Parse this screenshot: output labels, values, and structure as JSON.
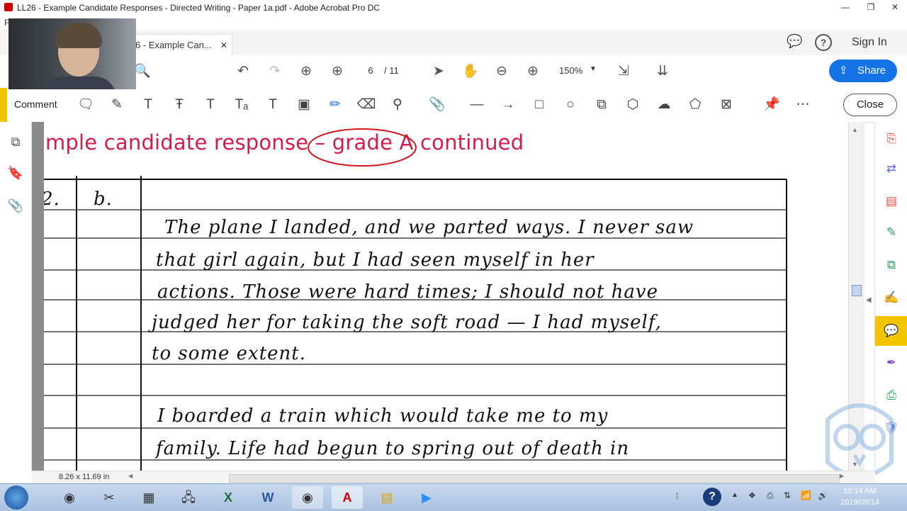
{
  "window": {
    "title": "LL26 - Example Candidate Responses - Directed Writing - Paper 1a.pdf - Adobe Acrobat Pro DC",
    "controls": [
      "—",
      "❐",
      "✕"
    ]
  },
  "menu": {
    "first": "F"
  },
  "tabs": [
    {
      "label": "6 - Example Can...",
      "close": "✕"
    }
  ],
  "topright": {
    "sign_in": "Sign In"
  },
  "toolbar": {
    "page_current": "6",
    "page_total": "/ 11",
    "zoom": "150%",
    "share_label": "Share"
  },
  "comment_toolbar": {
    "label": "Comment",
    "close_label": "Close"
  },
  "document": {
    "heading": "ample candidate response – grade A continued",
    "question_number": "2.",
    "question_letter": "b.",
    "handwriting": [
      "The plane I landed, and we parted ways. I never saw",
      "that girl again, but I had seen myself in her",
      "actions. Those were hard times; I should not have",
      "judged her for taking the soft road — I had myself,",
      "to some extent.",
      "",
      "I boarded a train which would take me to my",
      "family. Life had begun to spring out of death in"
    ]
  },
  "status": {
    "page_size": "8.26 x 11.69 in"
  },
  "taskbar": {
    "time": "10:14 AM",
    "date": "2019/08/14"
  },
  "colors": {
    "accent_blue": "#1473e6",
    "heading_red": "#d41b4a",
    "comment_yellow": "#f2c500"
  }
}
